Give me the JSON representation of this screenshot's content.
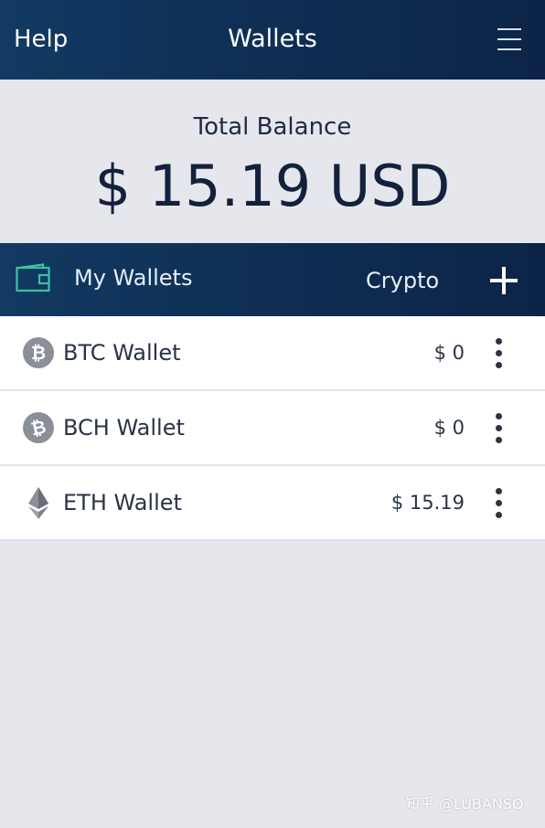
{
  "header": {
    "help_label": "Help",
    "title": "Wallets",
    "menu_icon": "hamburger-icon"
  },
  "balance": {
    "label": "Total Balance",
    "amount": "$ 15.19 USD"
  },
  "wallets_header": {
    "icon": "wallet-icon",
    "label": "My Wallets",
    "crypto_label": "Crypto",
    "add_icon": "plus-icon"
  },
  "wallets": [
    {
      "name": "BTC Wallet",
      "value": "$ 0",
      "icon": "bitcoin-icon"
    },
    {
      "name": "BCH Wallet",
      "value": "$ 0",
      "icon": "bitcoin-cash-icon"
    },
    {
      "name": "ETH Wallet",
      "value": "$ 15.19",
      "icon": "ethereum-icon"
    }
  ],
  "watermark": "知乎 @LUBANSO",
  "colors": {
    "header_bg": "#0f2f55",
    "page_bg": "#e6e7ec",
    "wallet_icon": "#3ec1a0",
    "coin_gray": "#8a8f98"
  }
}
